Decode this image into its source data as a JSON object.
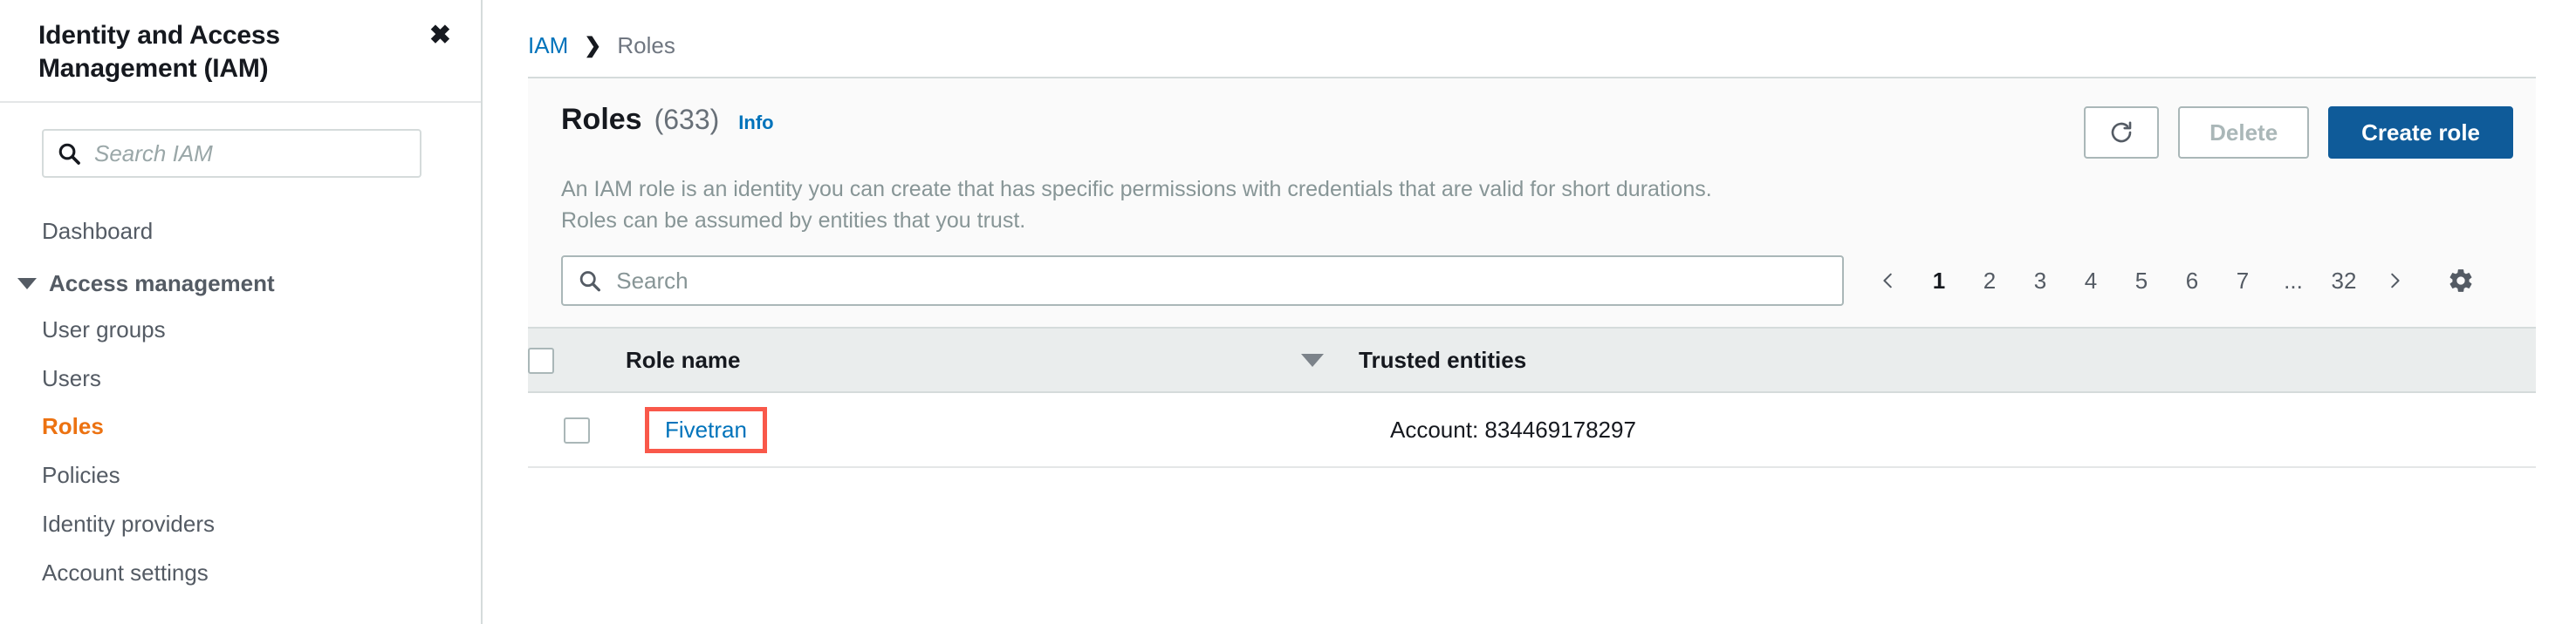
{
  "sidebar": {
    "title": "Identity and Access Management (IAM)",
    "close_icon": "close-icon",
    "search": {
      "placeholder": "Search IAM",
      "value": "",
      "icon": "search-icon"
    },
    "dashboard_label": "Dashboard",
    "group": {
      "label": "Access management",
      "expanded": true,
      "caret_icon": "caret-down-icon"
    },
    "items": [
      {
        "label": "User groups",
        "active": false
      },
      {
        "label": "Users",
        "active": false
      },
      {
        "label": "Roles",
        "active": true
      },
      {
        "label": "Policies",
        "active": false
      },
      {
        "label": "Identity providers",
        "active": false
      },
      {
        "label": "Account settings",
        "active": false
      }
    ],
    "active_color": "#ec7211"
  },
  "breadcrumb": {
    "root": "IAM",
    "separator": "›",
    "current": "Roles",
    "link_color": "#0073bb"
  },
  "header": {
    "title": "Roles",
    "count": "(633)",
    "info_label": "Info",
    "description": "An IAM role is an identity you can create that has specific permissions with credentials that are valid for short durations. Roles can be assumed by entities that you trust.",
    "refresh_icon": "refresh-icon",
    "delete_label": "Delete",
    "create_label": "Create role",
    "primary_color": "#0f5b99"
  },
  "toolbar": {
    "search": {
      "placeholder": "Search",
      "value": "",
      "icon": "search-icon"
    },
    "pagination": {
      "prev_icon": "chevron-left-icon",
      "next_icon": "chevron-right-icon",
      "pages": [
        "1",
        "2",
        "3",
        "4",
        "5",
        "6",
        "7",
        "...",
        "32"
      ],
      "current": "1"
    },
    "settings_icon": "gear-icon"
  },
  "table": {
    "columns": [
      {
        "key": "checkbox",
        "label": ""
      },
      {
        "key": "role_name",
        "label": "Role name",
        "sortable": true
      },
      {
        "key": "trusted_entities",
        "label": "Trusted entities"
      }
    ],
    "rows": [
      {
        "role_name": "Fivetran",
        "trusted_entities": "Account: 834469178297",
        "highlighted": true
      }
    ],
    "highlight_color": "#f9584a",
    "link_color": "#0073bb"
  }
}
